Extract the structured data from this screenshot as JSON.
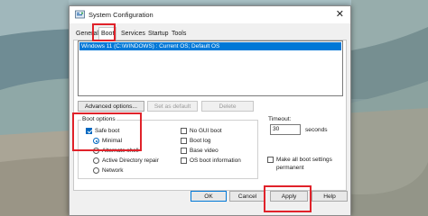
{
  "window": {
    "title": "System Configuration"
  },
  "tabs": [
    {
      "label": "General"
    },
    {
      "label": "Boot"
    },
    {
      "label": "Services"
    },
    {
      "label": "Startup"
    },
    {
      "label": "Tools"
    }
  ],
  "boot": {
    "os_entries": [
      "Windows 11 (C:\\WINDOWS) : Current OS; Default OS"
    ],
    "advanced_button": "Advanced options...",
    "set_default_button": "Set as default",
    "delete_button": "Delete",
    "boot_options_label": "Boot options",
    "safe_boot": {
      "label": "Safe boot",
      "checked": true
    },
    "safe_boot_modes": [
      {
        "label": "Minimal",
        "selected": true
      },
      {
        "label": "Alternate shell",
        "selected": false
      },
      {
        "label": "Active Directory repair",
        "selected": false
      },
      {
        "label": "Network",
        "selected": false
      }
    ],
    "right_options": [
      {
        "label": "No GUI boot",
        "checked": false
      },
      {
        "label": "Boot log",
        "checked": false
      },
      {
        "label": "Base video",
        "checked": false
      },
      {
        "label": "OS boot information",
        "checked": false
      }
    ],
    "timeout_label": "Timeout:",
    "timeout_value": "30",
    "timeout_unit": "seconds",
    "make_permanent_label_1": "Make all boot settings",
    "make_permanent_label_2": "permanent",
    "make_permanent_checked": false
  },
  "footer": {
    "ok": "OK",
    "cancel": "Cancel",
    "apply": "Apply",
    "help": "Help"
  },
  "colors": {
    "highlight": "#e0222a",
    "selection": "#0078d7"
  },
  "icons": {
    "app": "system-configuration-icon",
    "close": "close-icon"
  }
}
